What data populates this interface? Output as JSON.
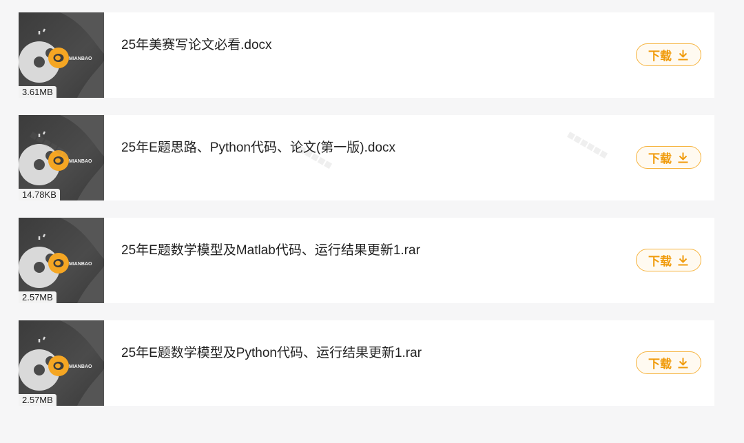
{
  "files": [
    {
      "name": "25年美赛写论文必看.docx",
      "size": "3.61MB"
    },
    {
      "name": "25年E题思路、Python代码、论文(第一版).docx",
      "size": "14.78KB"
    },
    {
      "name": "25年E题数学模型及Matlab代码、运行结果更新1.rar",
      "size": "2.57MB"
    },
    {
      "name": "25年E题数学模型及Python代码、运行结果更新1.rar",
      "size": "2.57MB"
    }
  ],
  "thumbnail": {
    "brand_text": "MIANBAO",
    "icon": "mianbao-donut-logo-icon"
  },
  "download_label": "下载",
  "download_icon": "download-arrow-icon",
  "colors": {
    "accent": "#f09b0c",
    "accent_border": "#f6b33d",
    "thumb_bg": "#444444",
    "logo_orange": "#f5a623"
  }
}
